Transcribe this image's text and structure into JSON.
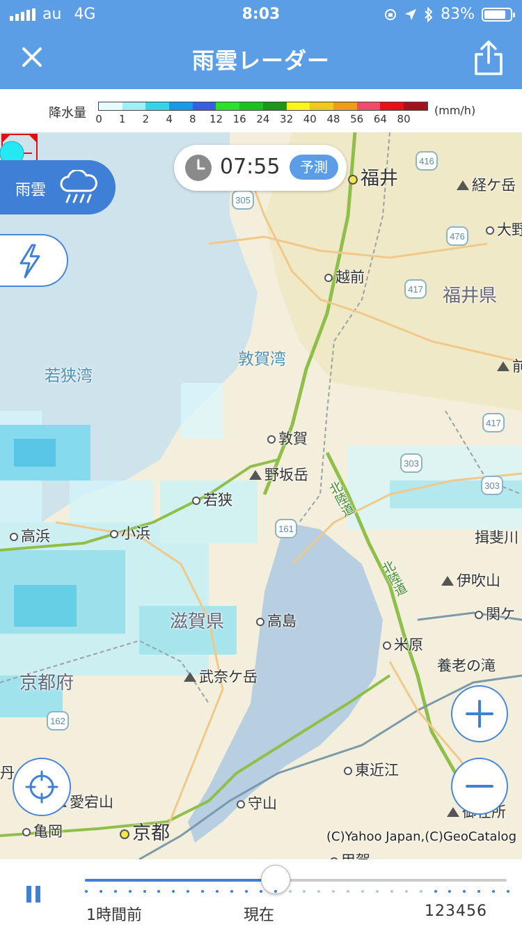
{
  "status_bar": {
    "carrier": "au",
    "network": "4G",
    "time": "8:03",
    "battery": "83%",
    "battery_level": 0.83
  },
  "header": {
    "title": "雨雲レーダー",
    "close_icon": "close-icon",
    "share_icon": "share-icon"
  },
  "legend": {
    "label": "降水量",
    "unit": "(mm/h)",
    "ticks": [
      "0",
      "1",
      "2",
      "4",
      "8",
      "12",
      "16",
      "24",
      "32",
      "40",
      "48",
      "56",
      "64",
      "80"
    ],
    "colors": [
      "#e8fbff",
      "#9ef0f6",
      "#34d4ee",
      "#1a99e8",
      "#3560e0",
      "#2ee02a",
      "#1cc21c",
      "#1a9818",
      "#fff51a",
      "#f2c81c",
      "#f29a1a",
      "#f24a6a",
      "#e81010",
      "#a8101e"
    ]
  },
  "map": {
    "time_badge": {
      "time": "07:55",
      "label": "予測"
    },
    "mode_tabs": {
      "raincloud": "雨雲",
      "lightning_icon": "lightning-icon"
    },
    "labels": {
      "fukui": "福井",
      "kyogatake": "経ケ岳",
      "ono": "大野",
      "echizen": "越前",
      "fukui_pref": "福井県",
      "tsuruga_bay": "敦賀湾",
      "wakasa_bay": "若狭湾",
      "tsuruga": "敦賀",
      "nosakadake": "野坂岳",
      "wakasa": "若狭",
      "takahama": "高浜",
      "obama": "小浜",
      "hokuriku1": "北陸道",
      "hokuriku2": "北陸道",
      "ibigawa": "揖斐川",
      "ibukiyama": "伊吹山",
      "sekigahara": "関ケ",
      "shiga_pref": "滋賀県",
      "takashima": "高島",
      "maibara": "米原",
      "yoronotaki": "養老の滝",
      "bunagatake": "武奈ケ岳",
      "kyoto_pref": "京都府",
      "higashiomi": "東近江",
      "atagoyama": "愛宕山",
      "moriyama": "守山",
      "kameoka": "亀岡",
      "kyoto": "京都",
      "gozaisho": "御在所",
      "koka": "甲賀",
      "tan": "丹",
      "mae": "前"
    },
    "routes": [
      "416",
      "305",
      "476",
      "417",
      "417",
      "303",
      "303",
      "161",
      "162"
    ],
    "copyright": "(C)Yahoo Japan,(C)GeoCatalog"
  },
  "controls": {
    "zoom_in": "+",
    "zoom_out": "−",
    "locate_icon": "crosshair-icon"
  },
  "timeline": {
    "left_label": "1時間前",
    "center_label": "現在",
    "right_label": "123456",
    "progress": 0.45,
    "pause_icon": "pause-icon"
  }
}
